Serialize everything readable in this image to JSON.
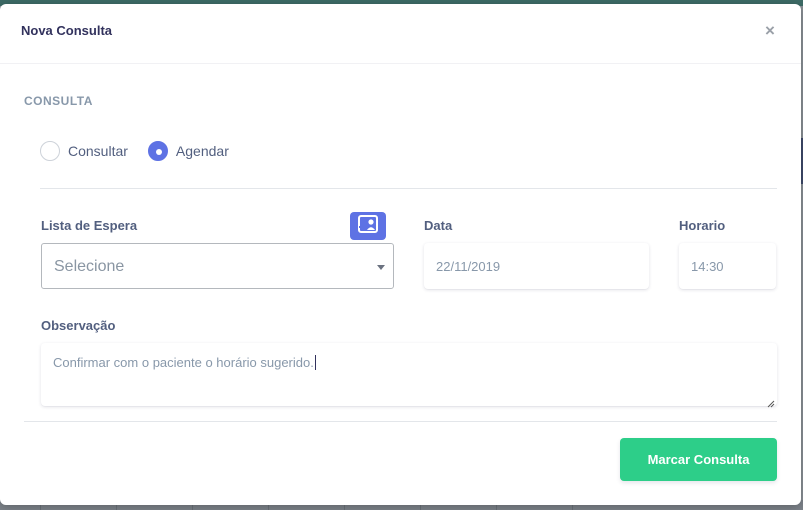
{
  "modal": {
    "title": "Nova Consulta",
    "close_symbol": "×"
  },
  "section": {
    "heading": "CONSULTA"
  },
  "mode": {
    "options": [
      {
        "label": "Consultar",
        "checked": false
      },
      {
        "label": "Agendar",
        "checked": true
      }
    ]
  },
  "form": {
    "waitlist_label": "Lista de Espera",
    "waitlist_value": "Selecione",
    "waitlist_button_icon": "contact-card-icon",
    "date_label": "Data",
    "date_value": "22/11/2019",
    "time_label": "Horario",
    "time_value": "14:30",
    "notes_label": "Observação",
    "notes_value": "Confirmar com o paciente o horário sugerido."
  },
  "actions": {
    "submit_label": "Marcar Consulta"
  },
  "colors": {
    "accent": "#5e72e4",
    "success": "#2dce89",
    "heading": "#32325d",
    "muted": "#8898aa"
  }
}
